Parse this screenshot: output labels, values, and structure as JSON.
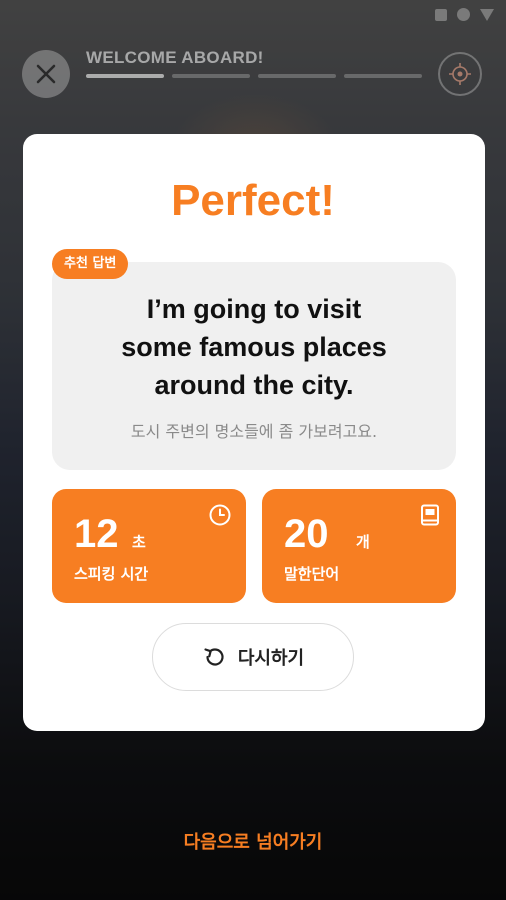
{
  "header": {
    "lesson_title": "WELCOME ABOARD!",
    "progress": {
      "completed_segments": 1,
      "total_segments": 4
    }
  },
  "icons": {
    "close": "close-icon",
    "target": "target-icon",
    "clock": "clock-icon",
    "book": "book-icon",
    "retry": "retry-icon"
  },
  "modal": {
    "title": "Perfect!",
    "badge": "추천 답변",
    "answer_lines": [
      "I’m going to visit",
      "some famous places",
      "around the city."
    ],
    "translation": "도시 주변의 명소들에 좀 가보려고요.",
    "stats": [
      {
        "value": "12",
        "unit": "초",
        "label": "스피킹 시간",
        "icon": "clock-icon"
      },
      {
        "value": "20",
        "unit": "개",
        "label": "말한단어",
        "icon": "book-icon"
      }
    ],
    "retry_label": "다시하기"
  },
  "footer": {
    "next_label": "다음으로 넘어가기"
  },
  "colors": {
    "accent": "#f77e22",
    "answer_bg": "#f0f0f0",
    "modal_bg": "#ffffff"
  }
}
